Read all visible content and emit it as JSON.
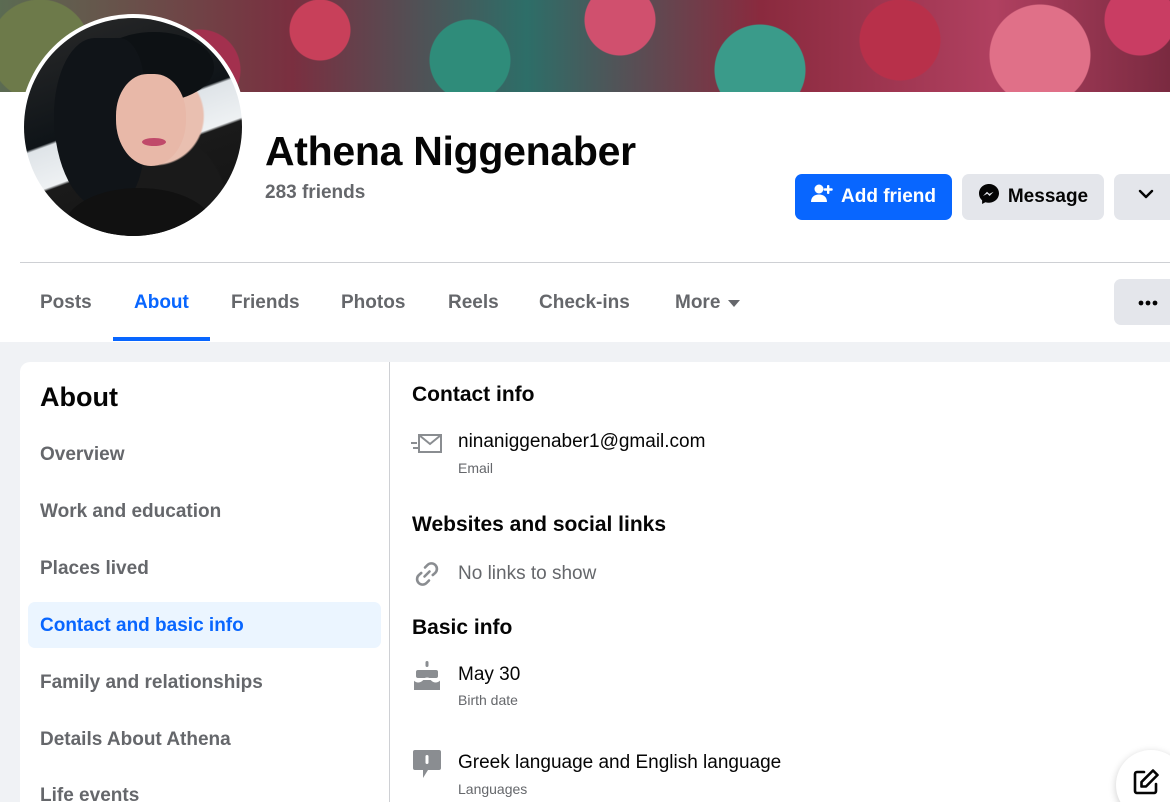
{
  "profile": {
    "name": "Athena Niggenaber",
    "friends_count": "283 friends"
  },
  "actions": {
    "add_friend": "Add friend",
    "message": "Message"
  },
  "tabs": [
    {
      "label": "Posts"
    },
    {
      "label": "About"
    },
    {
      "label": "Friends"
    },
    {
      "label": "Photos"
    },
    {
      "label": "Reels"
    },
    {
      "label": "Check-ins"
    },
    {
      "label": "More"
    }
  ],
  "about_nav": {
    "title": "About",
    "items": [
      {
        "label": "Overview"
      },
      {
        "label": "Work and education"
      },
      {
        "label": "Places lived"
      },
      {
        "label": "Contact and basic info"
      },
      {
        "label": "Family and relationships"
      },
      {
        "label": "Details About Athena"
      },
      {
        "label": "Life events"
      }
    ]
  },
  "contact": {
    "title": "Contact info",
    "email": "ninaniggenaber1@gmail.com",
    "email_label": "Email"
  },
  "websites": {
    "title": "Websites and social links",
    "empty": "No links to show"
  },
  "basic": {
    "title": "Basic info",
    "birth_date": "May 30",
    "birth_date_label": "Birth date",
    "languages": "Greek language and English language",
    "languages_label": "Languages"
  },
  "colors": {
    "accent": "#0866ff",
    "accent_bg": "#ebf5ff",
    "secondary_text": "#65676b",
    "button_gray": "#e4e6eb"
  }
}
